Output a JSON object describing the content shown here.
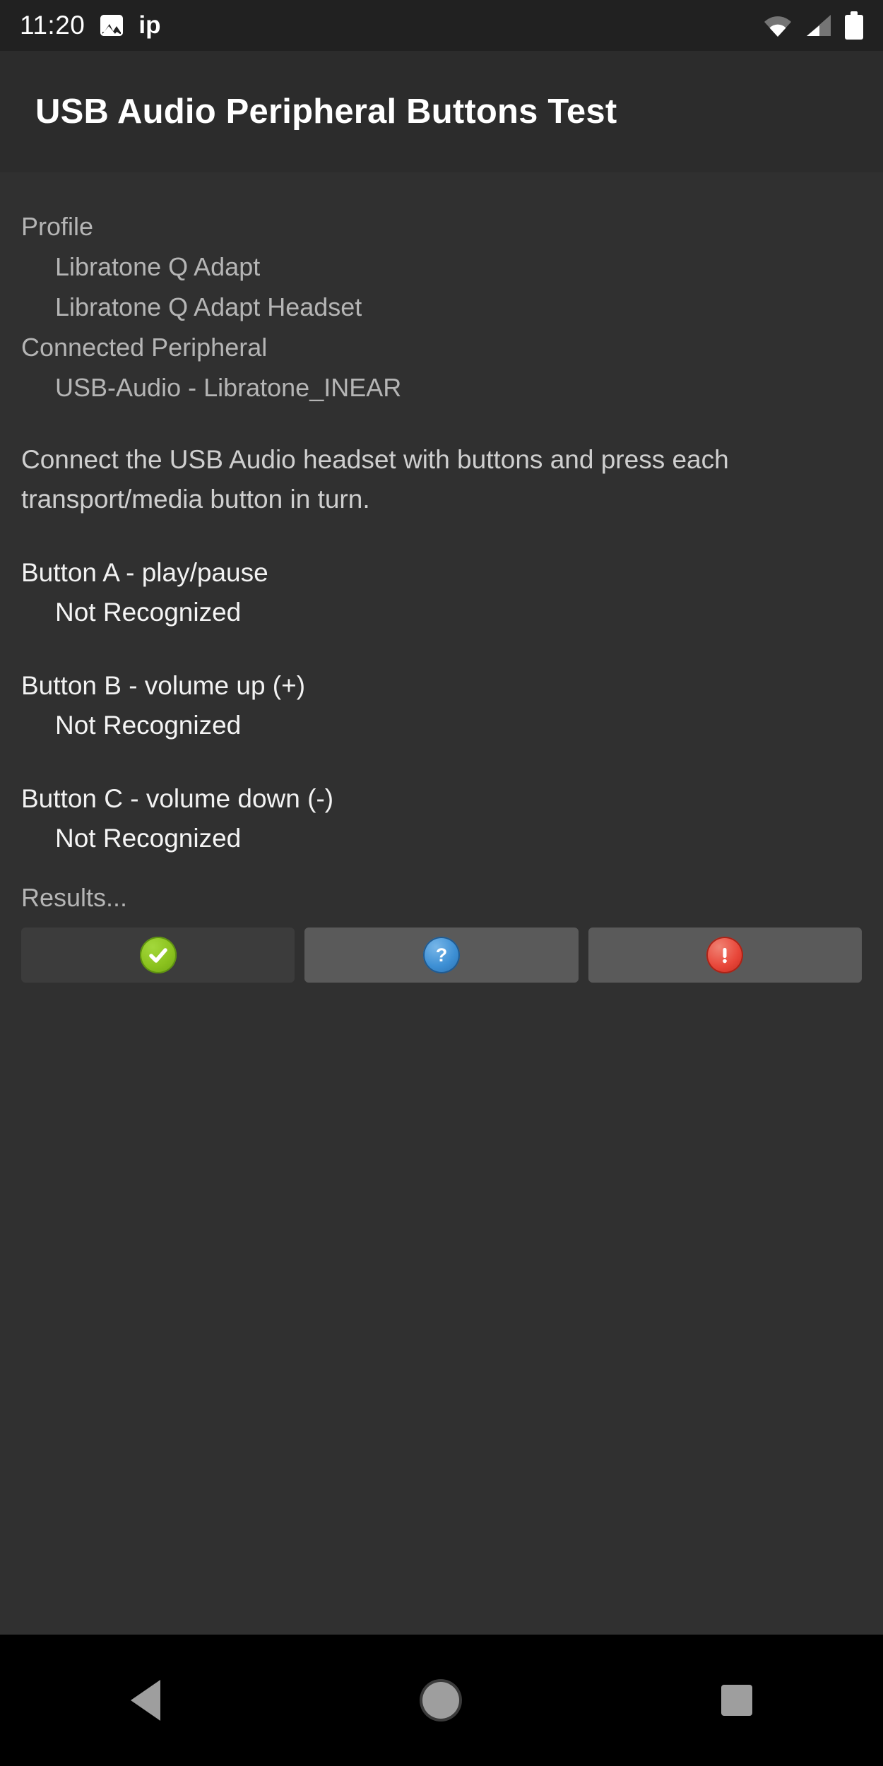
{
  "status_bar": {
    "time": "11:20",
    "notification_icons": [
      "image-icon"
    ],
    "notification_text": "ip",
    "right_icons": [
      "wifi-icon",
      "cellular-signal-icon",
      "battery-icon"
    ],
    "colors": {
      "background": "#212121",
      "foreground": "#ffffff"
    }
  },
  "app_bar": {
    "title": "USB Audio Peripheral Buttons Test",
    "background": "#2c2c2c"
  },
  "content": {
    "profile_label": "Profile",
    "profile_values": [
      "Libratone Q Adapt",
      "Libratone Q Adapt Headset"
    ],
    "connected_label": "Connected Peripheral",
    "connected_values": [
      "USB-Audio - Libratone_INEAR"
    ],
    "instructions": "Connect the USB Audio headset with buttons and press each transport/media button in turn.",
    "buttons_tests": [
      {
        "title": "Button A - play/pause",
        "state": "Not Recognized"
      },
      {
        "title": "Button B - volume up (+)",
        "state": "Not Recognized"
      },
      {
        "title": "Button C - volume down (-)",
        "state": "Not Recognized"
      }
    ],
    "results_label": "Results..."
  },
  "result_buttons": [
    {
      "name": "pass-button",
      "icon": "green-check-icon",
      "color": "#8bc21e",
      "background": "#3c3c3c"
    },
    {
      "name": "info-button",
      "icon": "blue-question-icon",
      "color": "#3d8fd4",
      "background": "#5a5a5a"
    },
    {
      "name": "fail-button",
      "icon": "red-exclamation-icon",
      "color": "#e8473a",
      "background": "#5a5a5a"
    }
  ],
  "nav_bar": {
    "items": [
      "back-icon",
      "home-icon",
      "recents-icon"
    ],
    "background": "#000000"
  }
}
